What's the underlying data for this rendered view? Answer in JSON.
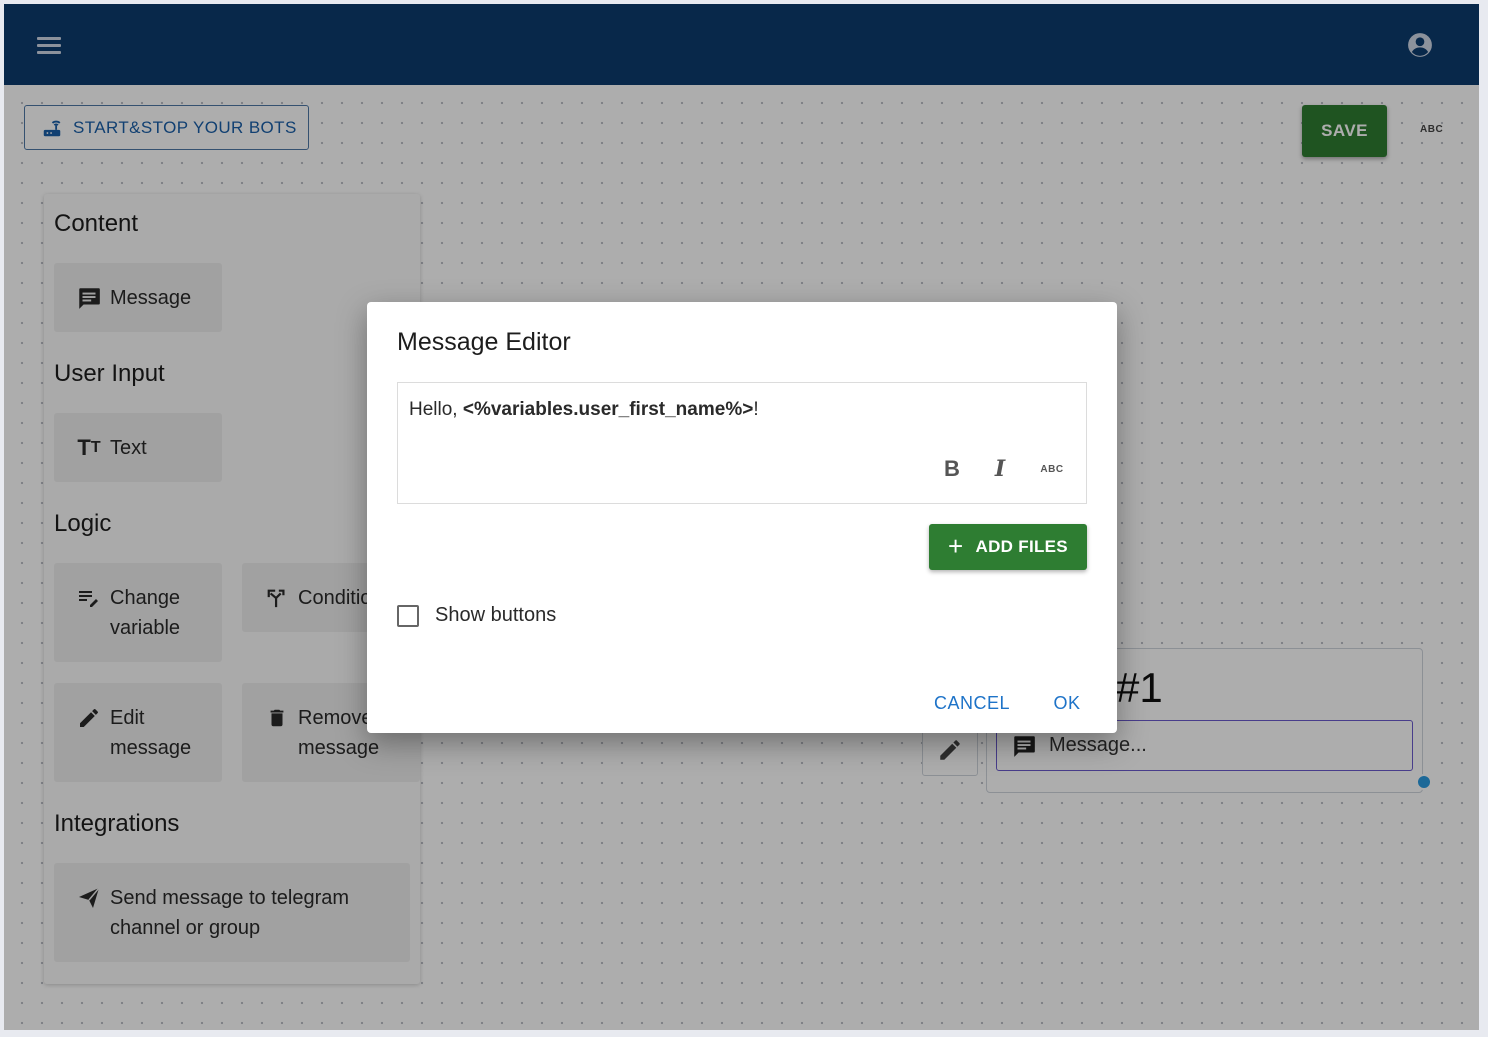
{
  "toolbar": {
    "start_stop_label": "START&STOP YOUR BOTS",
    "save_label": "SAVE",
    "spellcheck_label": "ABC"
  },
  "palette": {
    "sections": {
      "content": "Content",
      "user_input": "User Input",
      "logic": "Logic",
      "integrations": "Integrations"
    },
    "items": {
      "message": "Message",
      "text": "Text",
      "change_variable_line1": "Change",
      "change_variable_line2": "variable",
      "condition": "Conditio",
      "edit_message_line1": "Edit",
      "edit_message_line2": "message",
      "remove_message_line1": "Remove",
      "remove_message_line2": "message",
      "send_telegram_line1": "Send message to telegram",
      "send_telegram_line2": "channel or group"
    }
  },
  "node": {
    "title": "#1",
    "message_placeholder": "Message..."
  },
  "dialog": {
    "title": "Message Editor",
    "editor_prefix": "Hello, ",
    "editor_variable": "<%variables.user_first_name%>",
    "editor_suffix": "!",
    "bold_label": "B",
    "italic_label": "I",
    "spell_label": "ABC",
    "add_files_label": "ADD FILES",
    "show_buttons_label": "Show buttons",
    "cancel_label": "CANCEL",
    "ok_label": "OK"
  },
  "colors": {
    "appbar": "#0d3b6e",
    "primary_green": "#2e7d32",
    "link_blue": "#1e73c8"
  }
}
